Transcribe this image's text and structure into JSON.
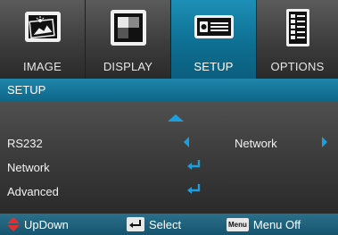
{
  "tabs": [
    {
      "label": "IMAGE",
      "icon": "image-icon"
    },
    {
      "label": "DISPLAY",
      "icon": "display-icon"
    },
    {
      "label": "SETUP",
      "icon": "setup-icon"
    },
    {
      "label": "OPTIONS",
      "icon": "options-icon"
    }
  ],
  "active_tab": "SETUP",
  "section_title": "SETUP",
  "rows": [
    {
      "label": "RS232",
      "value": "Network"
    },
    {
      "label": "Network"
    },
    {
      "label": "Advanced"
    }
  ],
  "footer": {
    "updown": "UpDown",
    "select": "Select",
    "menu_key": "Menu",
    "menu_off": "Menu Off"
  },
  "colors": {
    "accent": "#1aa0e0",
    "active_tab": "#0e6f93",
    "footer": "#1f617c",
    "updown_arrow": "#e03030"
  }
}
